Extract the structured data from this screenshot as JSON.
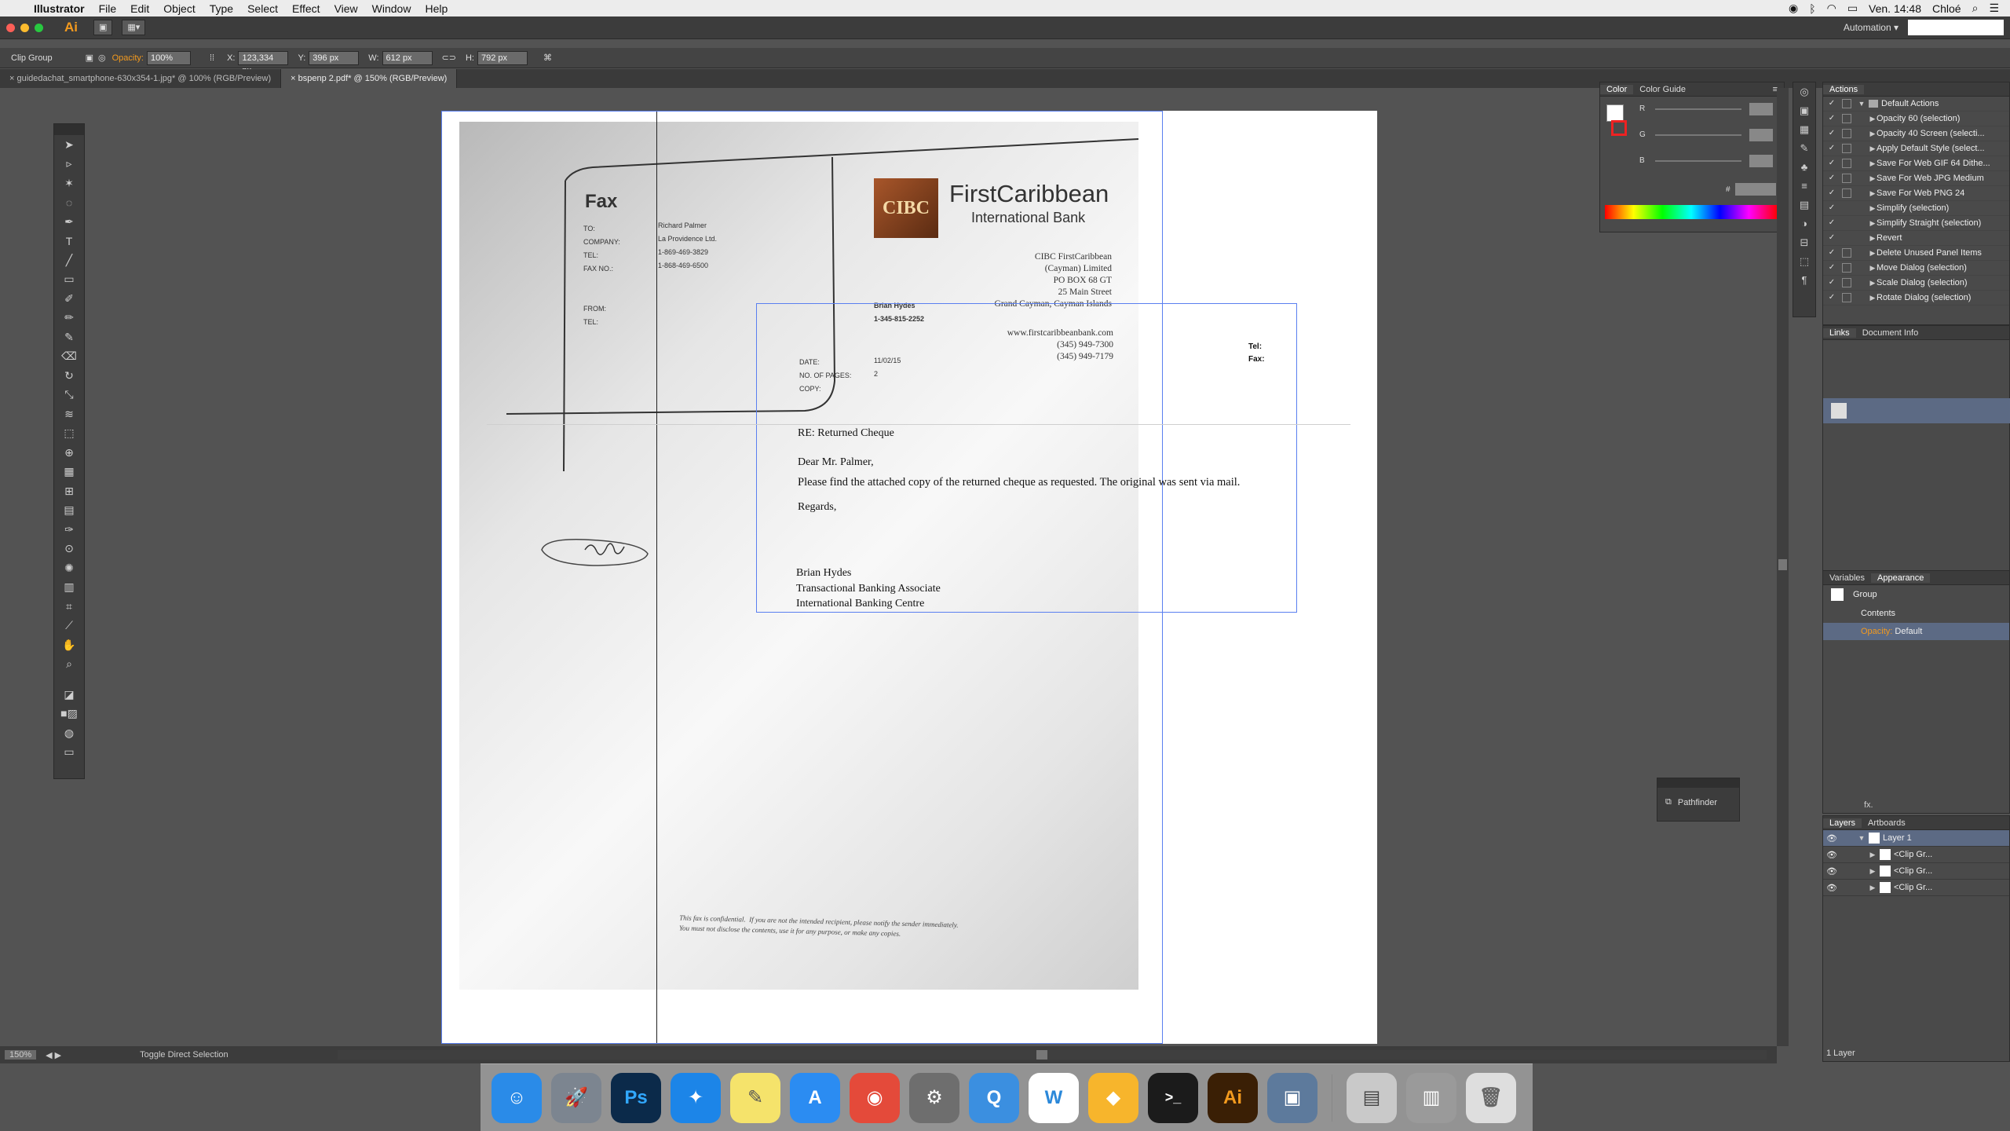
{
  "menubar": {
    "app": "Illustrator",
    "items": [
      "File",
      "Edit",
      "Object",
      "Type",
      "Select",
      "Effect",
      "View",
      "Window",
      "Help"
    ],
    "clock": "Ven. 14:48",
    "user": "Chloé"
  },
  "controlbar": {
    "ai": "Ai",
    "workspace": "Automation",
    "workspace_arrow": "▾"
  },
  "propbar": {
    "selection": "Clip Group",
    "opacity_label": "Opacity:",
    "opacity": "100%",
    "x_label": "X:",
    "x": "123,334 px",
    "y_label": "Y:",
    "y": "396 px",
    "w_label": "W:",
    "w": "612 px",
    "h_label": "H:",
    "h": "792 px"
  },
  "tabs": [
    {
      "label": "guidedachat_smartphone-630x354-1.jpg* @ 100% (RGB/Preview)"
    },
    {
      "label": "bspenp 2.pdf* @ 150% (RGB/Preview)"
    }
  ],
  "document": {
    "fax": "Fax",
    "to_labels": "TO:\nCOMPANY:\nTEL:\nFAX NO.:",
    "to_values": "Richard Palmer\nLa Providence Ltd.\n1-869-469-3829\n1-868-469-6500",
    "from_labels": "FROM:\nTEL:",
    "from_values": "Brian Hydes\n1-345-815-2252",
    "date_labels": "DATE:\nNO. OF PAGES:\nCOPY:",
    "date_values": "11/02/15\n2",
    "logo": "CIBC",
    "bank_name": "FirstCaribbean",
    "bank_sub": "International Bank",
    "address": "CIBC FirstCaribbean\n(Cayman) Limited\nPO BOX 68 GT\n25 Main Street\nGrand Cayman, Cayman Islands",
    "web": "www.firstcaribbeanbank.com\n(345) 949-7300\n(345) 949-7179",
    "tel": "Tel:",
    "fax_lbl": "Fax:",
    "footer": "This fax is confidential.  If you are not the intended recipient, please notify the sender immediately.\nYou must not disclose the contents, use it for any purpose, or make any copies."
  },
  "letter": {
    "re": "RE: Returned Cheque",
    "greeting": "Dear Mr. Palmer,",
    "body": "Please find the attached copy of the returned cheque as requested.  The original was sent via mail.",
    "regards": "Regards,",
    "name": "Brian Hydes",
    "title": "Transactional Banking Associate",
    "dept": "International Banking Centre"
  },
  "color_panel": {
    "tabs": [
      "Color",
      "Color Guide"
    ],
    "r": "R",
    "g": "G",
    "b": "B",
    "hash": "#"
  },
  "actions_panel": {
    "title": "Actions",
    "set": "Default Actions",
    "items": [
      "Opacity 60 (selection)",
      "Opacity 40 Screen (selecti...",
      "Apply Default Style (select...",
      "Save For Web GIF 64 Dithe...",
      "Save For Web JPG Medium",
      "Save For Web PNG 24",
      "Simplify (selection)",
      "Simplify Straight (selection)",
      "Revert",
      "Delete Unused Panel Items",
      "Move Dialog (selection)",
      "Scale Dialog (selection)",
      "Rotate Dialog (selection)"
    ]
  },
  "links_panel": {
    "tabs": [
      "Links",
      "Document Info"
    ]
  },
  "appearance_panel": {
    "tabs": [
      "Variables",
      "Appearance"
    ],
    "object": "Group",
    "contents": "Contents",
    "opacity_label": "Opacity:",
    "opacity_value": "Default",
    "fx": "fx."
  },
  "layers_panel": {
    "tabs": [
      "Layers",
      "Artboards"
    ],
    "layer": "Layer 1",
    "items": [
      "<Clip Gr...",
      "<Clip Gr...",
      "<Clip Gr..."
    ],
    "count": "1 Layer"
  },
  "pathfinder": {
    "label": "Pathfinder"
  },
  "status": {
    "zoom": "150%",
    "tool": "Toggle Direct Selection"
  },
  "dock": {
    "apps": [
      {
        "name": "Finder",
        "glyph": "☺",
        "color": "#2a8be8"
      },
      {
        "name": "Launchpad",
        "glyph": "🚀",
        "color": "#7c8590"
      },
      {
        "name": "Photoshop",
        "glyph": "Ps",
        "color": "#0b2a4a"
      },
      {
        "name": "Safari",
        "glyph": "✦",
        "color": "#1c85e8"
      },
      {
        "name": "Notes",
        "glyph": "✎",
        "color": "#f5e36b"
      },
      {
        "name": "App Store",
        "glyph": "A",
        "color": "#2b8cf2"
      },
      {
        "name": "Chrome",
        "glyph": "◉",
        "color": "#e44a3a"
      },
      {
        "name": "System Preferences",
        "glyph": "⚙",
        "color": "#6e6e6e"
      },
      {
        "name": "Messages",
        "glyph": "Q",
        "color": "#3b8fe0"
      },
      {
        "name": "Wunderlist",
        "glyph": "W",
        "color": "#ffffff"
      },
      {
        "name": "Sketch",
        "glyph": "◆",
        "color": "#f7b52c"
      },
      {
        "name": "Terminal",
        "glyph": ">_",
        "color": "#1b1b1b"
      },
      {
        "name": "Illustrator",
        "glyph": "Ai",
        "color": "#3a1f05"
      },
      {
        "name": "Preview",
        "glyph": "▣",
        "color": "#5d7a9c"
      },
      {
        "name": "Downloads",
        "glyph": "▤",
        "color": "#c9c9c9"
      },
      {
        "name": "Screens",
        "glyph": "▥",
        "color": "#9a9a9a"
      },
      {
        "name": "Trash",
        "glyph": "🗑",
        "color": "#dedede"
      }
    ]
  }
}
